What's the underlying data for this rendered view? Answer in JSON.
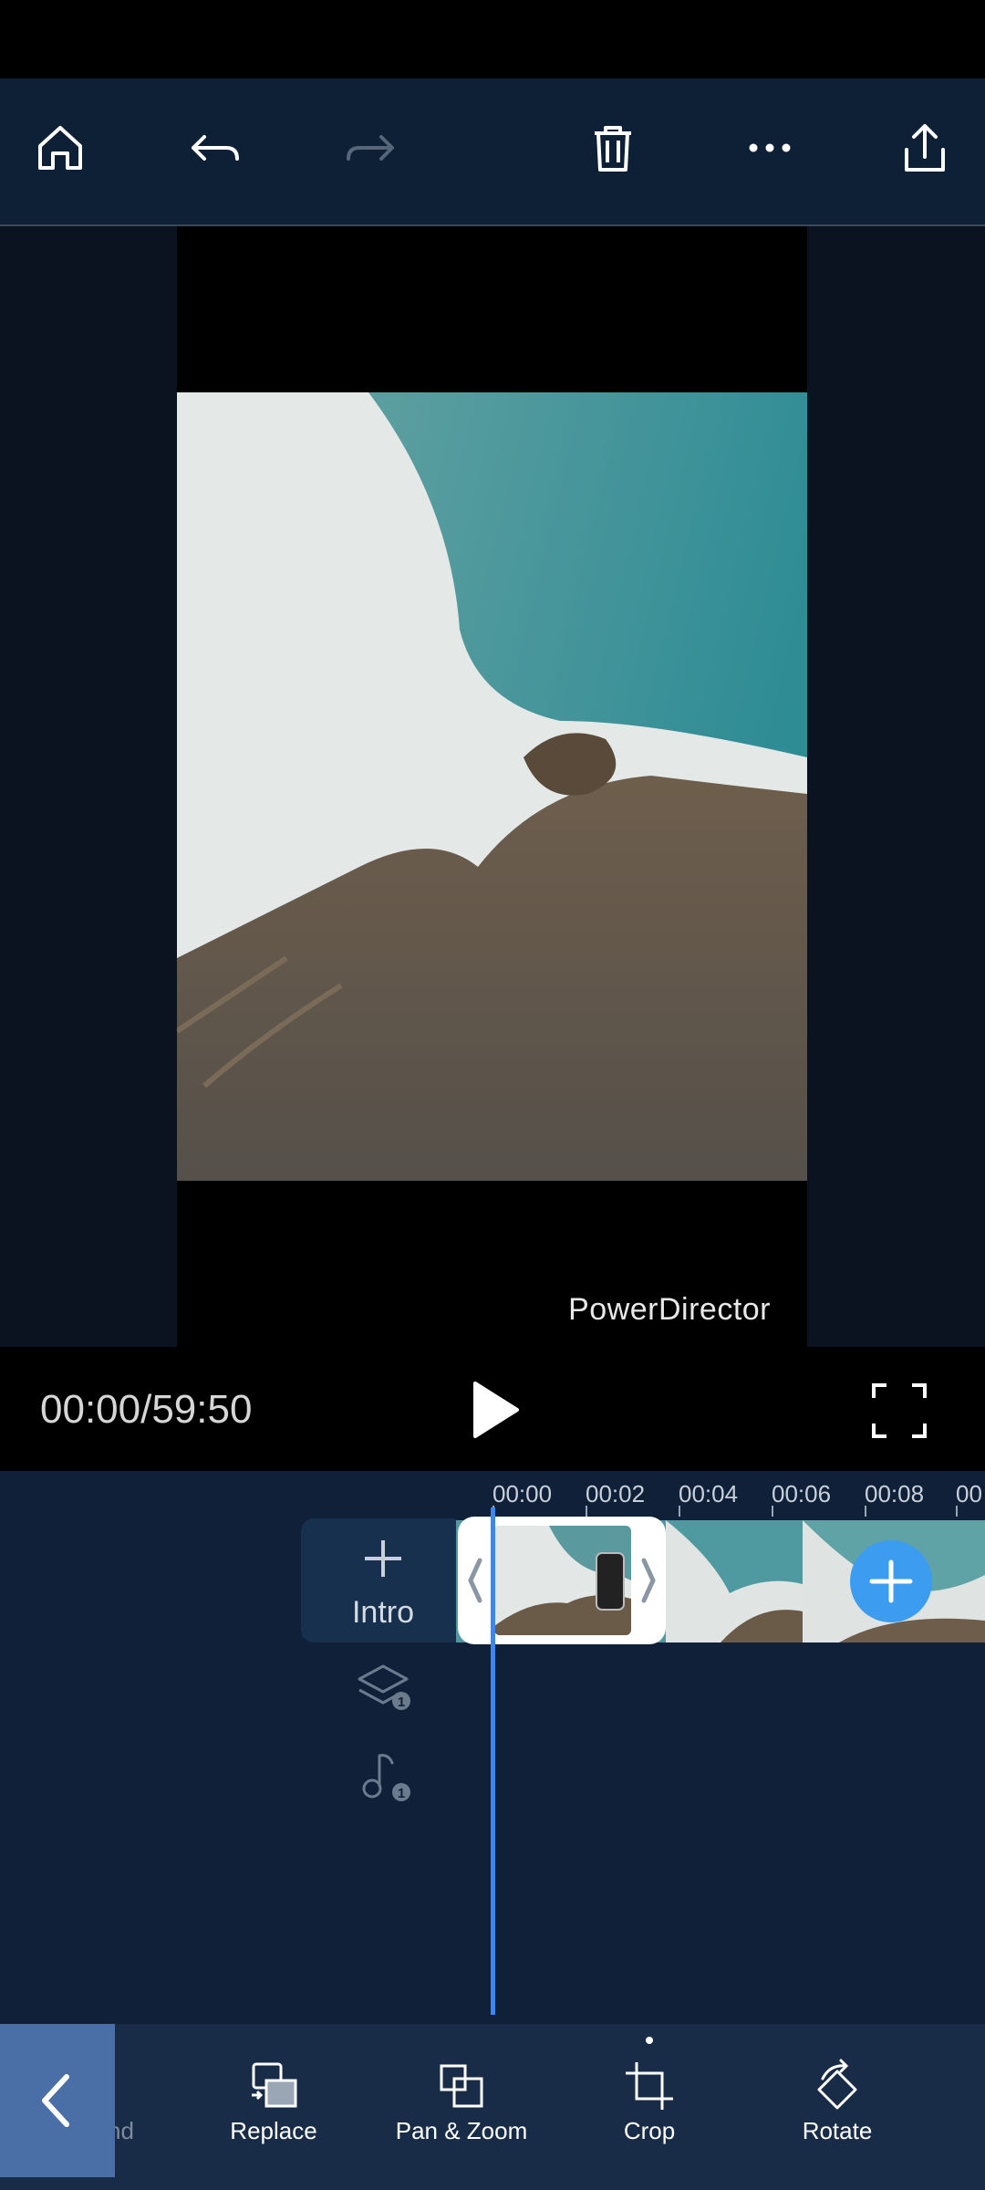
{
  "toolbar": {
    "home": "home-icon",
    "undo": "undo-icon",
    "redo": "redo-icon",
    "delete": "trash-icon",
    "more": "more-icon",
    "share": "share-icon"
  },
  "preview": {
    "watermark": "PowerDirector"
  },
  "playback": {
    "timecode": "00:00/59:50"
  },
  "timeline": {
    "ruler": [
      "00:00",
      "00:02",
      "00:04",
      "00:06",
      "00:08",
      "00"
    ],
    "intro_label": "Intro",
    "layer_count": "1",
    "music_count": "1"
  },
  "bottom_tools": {
    "partial_label": "nd",
    "items": [
      {
        "label": "Replace",
        "icon": "replace-icon"
      },
      {
        "label": "Pan & Zoom",
        "icon": "pan-zoom-icon"
      },
      {
        "label": "Crop",
        "icon": "crop-icon"
      },
      {
        "label": "Rotate",
        "icon": "rotate-icon"
      }
    ]
  },
  "colors": {
    "accent": "#3b9cf0",
    "playhead": "#3d86f0",
    "toolbar_bg": "#0e2036",
    "bottom_bg": "#182c48"
  }
}
